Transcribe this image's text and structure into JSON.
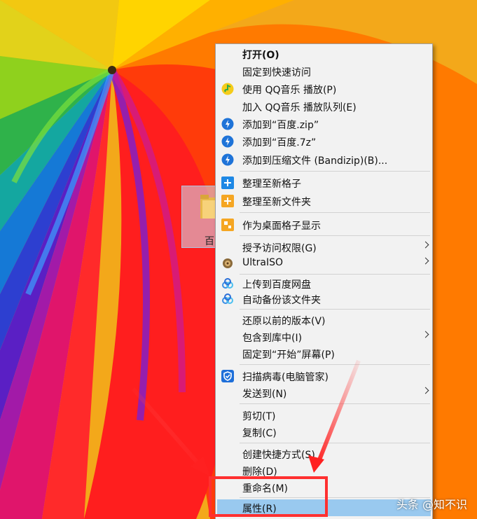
{
  "desktop": {
    "icon_label": "百"
  },
  "context_menu": {
    "items": [
      {
        "label": "打开(O)"
      },
      {
        "label": "固定到快速访问"
      },
      {
        "label": "使用 QQ音乐 播放(P)"
      },
      {
        "label": "加入 QQ音乐 播放队列(E)"
      },
      {
        "label": "添加到“百度.zip”"
      },
      {
        "label": "添加到“百度.7z”"
      },
      {
        "label": "添加到压缩文件 (Bandizip)(B)..."
      },
      {
        "label": "整理至新格子"
      },
      {
        "label": "整理至新文件夹"
      },
      {
        "label": "作为桌面格子显示"
      },
      {
        "label": "授予访问权限(G)"
      },
      {
        "label": "UltraISO"
      },
      {
        "label": "上传到百度网盘"
      },
      {
        "label": "自动备份该文件夹"
      },
      {
        "label": "还原以前的版本(V)"
      },
      {
        "label": "包含到库中(I)"
      },
      {
        "label": "固定到“开始”屏幕(P)"
      },
      {
        "label": "扫描病毒(电脑管家)"
      },
      {
        "label": "发送到(N)"
      },
      {
        "label": "剪切(T)"
      },
      {
        "label": "复制(C)"
      },
      {
        "label": "创建快捷方式(S)"
      },
      {
        "label": "删除(D)"
      },
      {
        "label": "重命名(M)"
      },
      {
        "label": "属性(R)"
      }
    ]
  },
  "watermark": "头条 @知不识",
  "colors": {
    "highlight": "#99c9ef",
    "annotation": "#ff3030",
    "menu_bg": "#f2f2f2"
  }
}
